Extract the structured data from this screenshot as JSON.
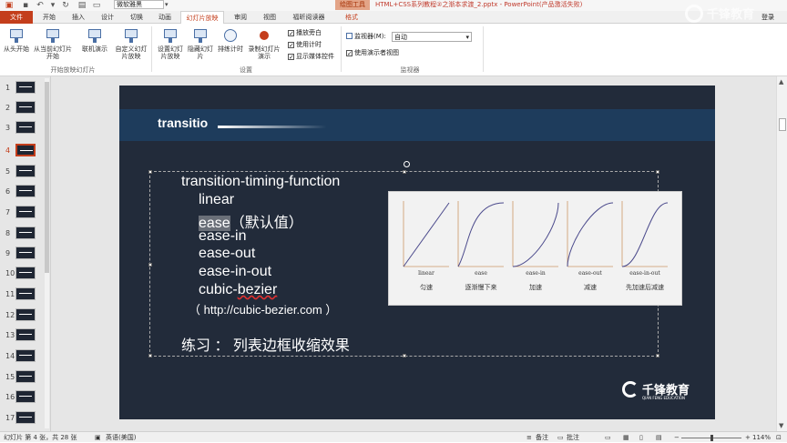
{
  "quick_access": {
    "font_name": "微软雅黑",
    "context_tools": "绘图工具",
    "doc_title": "HTML+CSS系列教程②之渐本求渡_2.pptx - PowerPoint(产品激活失败)"
  },
  "watermark": {
    "text": "千锋教育"
  },
  "ribbon_tabs": [
    "文件",
    "开始",
    "插入",
    "设计",
    "切换",
    "动画",
    "幻灯片放映",
    "审阅",
    "视图",
    "福昕阅读器",
    "格式"
  ],
  "active_tab_index": 6,
  "login_label": "登录",
  "ribbon": {
    "start": {
      "from_beginning": "从头开始",
      "from_current": "从当前幻灯片开始",
      "online": "联机演示",
      "custom": "自定义幻灯片放映",
      "group_label": "开始放映幻灯片"
    },
    "setup": {
      "setup_show": "设置幻灯片放映",
      "hide_slide": "隐藏幻灯片",
      "rehearse": "排练计时",
      "record": "录制幻灯片演示",
      "check_narration": "播放旁白",
      "check_timings": "使用计时",
      "check_media": "显示媒体控件",
      "group_label": "设置"
    },
    "monitors": {
      "monitor_label": "监视器(M):",
      "monitor_value": "自动",
      "presenter_view": "使用演示者视图",
      "group_label": "监视器"
    }
  },
  "thumbnails": {
    "numbers": [
      "1",
      "2",
      "3",
      "4",
      "5",
      "6",
      "7",
      "8",
      "9",
      "10",
      "11",
      "12",
      "13",
      "14",
      "15",
      "16",
      "17"
    ],
    "selected": "4"
  },
  "slide": {
    "banner_title": "transitio",
    "lines": {
      "heading": "transition-timing-function",
      "item1": "linear",
      "item2_highlight": "ease",
      "item2_note": "（默认值）",
      "item3": "ease-in",
      "item4": "ease-out",
      "item5": "ease-in-out",
      "item6_prefix": "cubic-",
      "item6_error": "bezier",
      "url": "（  http://cubic-bezier.com  ）",
      "exercise": "练习 ： 列表边框收缩效果"
    },
    "figure": {
      "curves": [
        {
          "label": "linear",
          "desc": "匀速"
        },
        {
          "label": "ease",
          "desc": "逐渐慢下来"
        },
        {
          "label": "ease-in",
          "desc": "加速"
        },
        {
          "label": "ease-out",
          "desc": "减速"
        },
        {
          "label": "ease-in-out",
          "desc": "先加速后减速"
        }
      ]
    },
    "logo": {
      "name": "千锋教育",
      "sub": "QIAN FENG EDUCATION"
    }
  },
  "status": {
    "slide_info": "幻灯片 第 4 张，共 28 张",
    "language": "英语(美国)",
    "notes": "备注",
    "comments": "批注",
    "zoom": "114%"
  }
}
